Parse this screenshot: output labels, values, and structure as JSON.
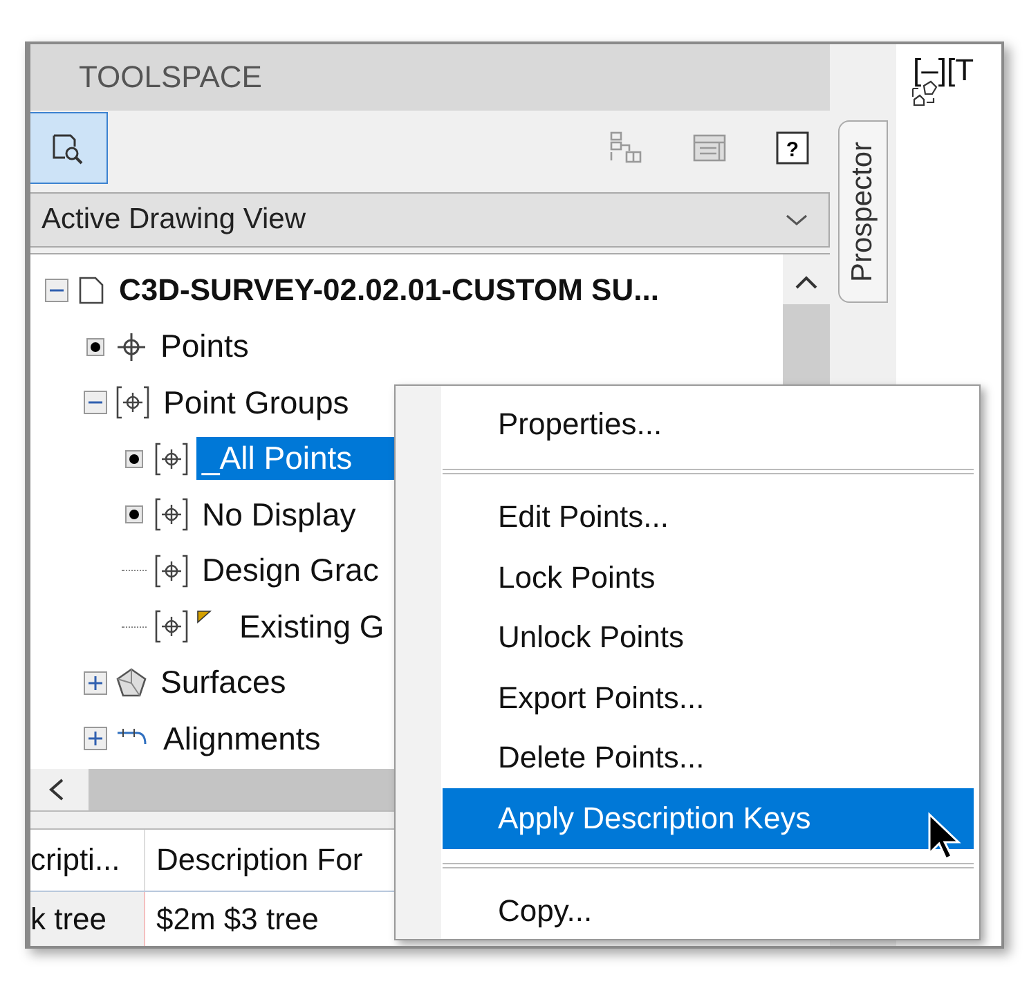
{
  "toolspace": {
    "title": "TOOLSPACE",
    "help_button": "?",
    "view_dropdown": {
      "value": "Active Drawing View"
    },
    "tab": {
      "label": "Prospector",
      "selected": true
    }
  },
  "tree": [
    {
      "label": "C3D-SURVEY-02.02.01-CUSTOM SU...",
      "kind": "drawing",
      "expanded": true,
      "selected": false,
      "flagged": false,
      "children": [
        {
          "label": "Points",
          "kind": "points",
          "has_content": true,
          "selected": false,
          "flagged": false
        },
        {
          "label": "Point Groups",
          "kind": "group",
          "expanded": true,
          "selected": false,
          "flagged": false,
          "children": [
            {
              "label": "_All Points",
              "kind": "group",
              "has_content": true,
              "selected": true,
              "flagged": false
            },
            {
              "label": "No Display",
              "kind": "group",
              "has_content": true,
              "selected": false,
              "flagged": false
            },
            {
              "label": "Design Grac",
              "kind": "group",
              "has_content": false,
              "selected": false,
              "flagged": false
            },
            {
              "label": "Existing G",
              "kind": "group",
              "has_content": false,
              "selected": false,
              "flagged": true
            }
          ]
        },
        {
          "label": "Surfaces",
          "kind": "surface",
          "expanded": false,
          "selected": false,
          "flagged": false
        },
        {
          "label": "Alignments",
          "kind": "alignment",
          "expanded": false,
          "selected": false,
          "flagged": false
        }
      ]
    }
  ],
  "table": {
    "columns": [
      "cripti...",
      "Description For"
    ],
    "rows": [
      [
        "k tree",
        "$2m $3 tree"
      ]
    ]
  },
  "drawing_area": {
    "viewport_label": "[–][T"
  },
  "context_menu": [
    {
      "kind": "item",
      "label": "Properties...",
      "selected": false
    },
    {
      "kind": "separator"
    },
    {
      "kind": "item",
      "label": "Edit Points...",
      "selected": false
    },
    {
      "kind": "item",
      "label": "Lock Points",
      "selected": false
    },
    {
      "kind": "item",
      "label": "Unlock Points",
      "selected": false
    },
    {
      "kind": "item",
      "label": "Export Points...",
      "selected": false
    },
    {
      "kind": "item",
      "label": "Delete Points...",
      "selected": false
    },
    {
      "kind": "item",
      "label": "Apply Description Keys",
      "selected": true
    },
    {
      "kind": "separator"
    },
    {
      "kind": "item",
      "label": "Copy...",
      "selected": false
    }
  ]
}
